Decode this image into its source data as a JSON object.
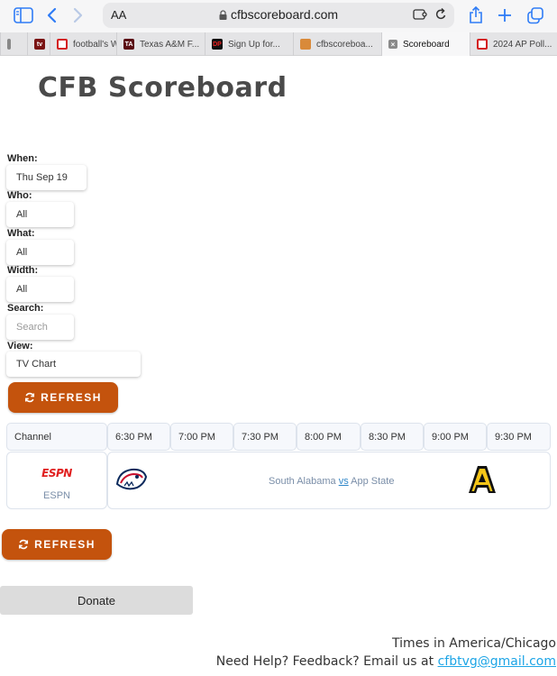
{
  "browser": {
    "aa_label": "AA",
    "url": "cfbscoreboard.com",
    "tabs": [
      {
        "label": "",
        "favicon": ""
      },
      {
        "label": "",
        "favicon": "tv"
      },
      {
        "label": "football's W",
        "favicon": ""
      },
      {
        "label": "Texas A&M F...",
        "favicon": "TA"
      },
      {
        "label": "Sign Up for...",
        "favicon": "DP"
      },
      {
        "label": "cfbscoreboa...",
        "favicon": ""
      },
      {
        "label": "Scoreboard",
        "favicon": ""
      },
      {
        "label": "2024 AP Poll...",
        "favicon": ""
      }
    ]
  },
  "page": {
    "title": "CFB Scoreboard"
  },
  "filters": {
    "when_label": "When:",
    "when_value": "Thu Sep 19",
    "who_label": "Who:",
    "who_value": "All",
    "what_label": "What:",
    "what_value": "All",
    "width_label": "Width:",
    "width_value": "All",
    "search_label": "Search:",
    "search_placeholder": "Search",
    "view_label": "View:",
    "view_value": "TV Chart"
  },
  "actions": {
    "refresh_label": "REFRESH",
    "donate_label": "Donate"
  },
  "chart": {
    "channel_header": "Channel",
    "times": [
      "6:30 PM",
      "7:00 PM",
      "7:30 PM",
      "8:00 PM",
      "8:30 PM",
      "9:00 PM",
      "9:30 PM"
    ],
    "rows": [
      {
        "channel_logo": "ESPN",
        "channel_name": "ESPN",
        "home_team": "South Alabama",
        "vs": "vs",
        "away_team": "App State",
        "away_logo_letter": "A"
      }
    ]
  },
  "footer": {
    "timezone": "Times in America/Chicago",
    "help_text": "Need Help? Feedback? Email us at ",
    "email": "cfbtvg@gmail.com"
  },
  "colors": {
    "accent": "#c4530d",
    "espn_red": "#e02020",
    "app_state_gold": "#f5c518",
    "link": "#1da5e6"
  }
}
